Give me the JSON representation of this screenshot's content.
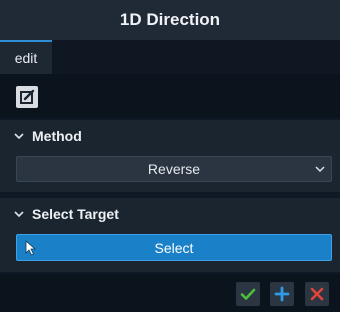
{
  "window": {
    "title": "1D Direction"
  },
  "tabs": [
    {
      "label": "edit",
      "active": true
    }
  ],
  "toolbar": {
    "edit_icon": "edit-square-icon"
  },
  "sections": {
    "method": {
      "title": "Method",
      "dropdown_value": "Reverse",
      "dropdown_icon": "chevron-down-icon"
    },
    "select_target": {
      "title": "Select Target",
      "button_label": "Select",
      "button_icon": "cursor-arrow-icon"
    }
  },
  "footer": {
    "ok_icon": "checkmark-icon",
    "add_icon": "plus-icon",
    "cancel_icon": "close-icon"
  },
  "colors": {
    "accent": "#1a80c8",
    "ok": "#4bbf3a",
    "add": "#2f9be8",
    "cancel": "#e0443a"
  }
}
